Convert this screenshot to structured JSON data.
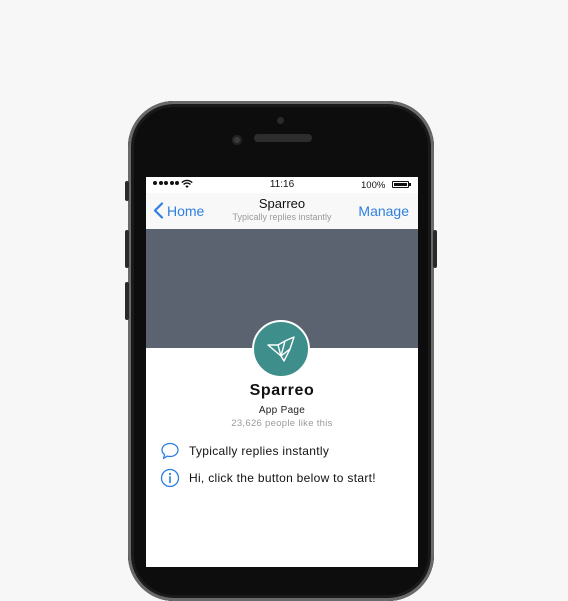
{
  "status": {
    "time": "11:16",
    "battery": "100%"
  },
  "nav": {
    "back_label": "Home",
    "title": "Sparreo",
    "subtitle": "Typically replies instantly",
    "manage_label": "Manage"
  },
  "page": {
    "name": "Sparreo",
    "type": "App Page",
    "likes": "23,626 people like this"
  },
  "info": [
    {
      "icon": "chat-bubble-icon",
      "text": "Typically replies instantly"
    },
    {
      "icon": "info-icon",
      "text": "Hi, click the button below to start!"
    }
  ],
  "colors": {
    "accent": "#2d7fe0",
    "avatar": "#3e8f8c",
    "cover": "#5b6270"
  }
}
